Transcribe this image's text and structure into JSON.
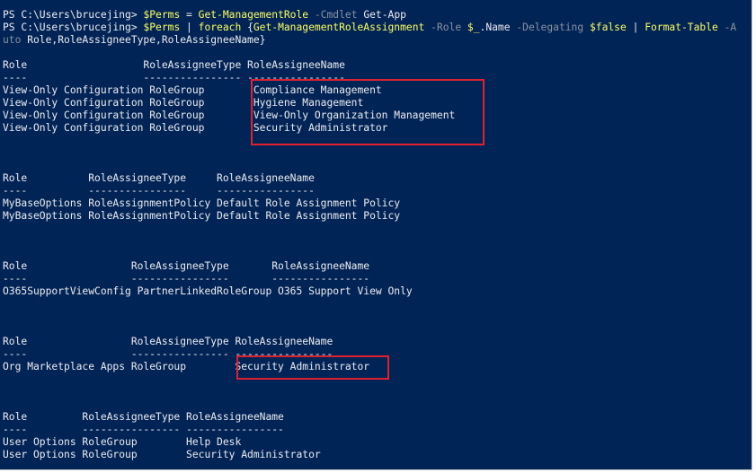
{
  "prompt": {
    "line1": {
      "ps": "PS C:\\Users\\brucejing> ",
      "var": "$Perms",
      "eq": " = ",
      "cmd": "Get-ManagementRole",
      "param": " -Cmdlet",
      "arg": " Get-App"
    },
    "line2": {
      "ps": "PS C:\\Users\\brucejing> ",
      "var": "$Perms",
      "pipe": " | ",
      "kw": "foreach",
      "brace": " {",
      "cmd": "Get-ManagementRoleAssignment",
      "p_role": " -Role ",
      "var2": "$_",
      "name": ".Name",
      "p_deleg": " -Delegating ",
      "var_false": "$false",
      "pipe2": " | ",
      "cmd2": "Format-Table",
      "param_a": " -A"
    },
    "line3": {
      "wrap": "uto",
      "args": " Role,RoleAssigneeType,RoleAssigneeName}"
    }
  },
  "blocks": [
    {
      "header": "Role                   RoleAssigneeType RoleAssigneeName",
      "underline": "----                   ---------------- ----------------",
      "rows": [
        "View-Only Configuration RoleGroup        Compliance Management",
        "View-Only Configuration RoleGroup        Hygiene Management",
        "View-Only Configuration RoleGroup        View-Only Organization Management",
        "View-Only Configuration RoleGroup        Security Administrator"
      ]
    },
    {
      "header": "Role          RoleAssigneeType     RoleAssigneeName",
      "underline": "----          ----------------     ----------------",
      "rows": [
        "MyBaseOptions RoleAssignmentPolicy Default Role Assignment Policy",
        "MyBaseOptions RoleAssignmentPolicy Default Role Assignment Policy"
      ]
    },
    {
      "header": "Role                 RoleAssigneeType       RoleAssigneeName",
      "underline": "----                 ----------------       ----------------",
      "rows": [
        "O365SupportViewConfig PartnerLinkedRoleGroup O365 Support View Only"
      ]
    },
    {
      "header": "Role                 RoleAssigneeType RoleAssigneeName",
      "underline": "----                 ---------------- ----------------",
      "rows": [
        "Org Marketplace Apps RoleGroup        Security Administrator"
      ]
    },
    {
      "header": "Role         RoleAssigneeType RoleAssigneeName",
      "underline": "----         ---------------- ----------------",
      "rows": [
        "User Options RoleGroup        Help Desk",
        "User Options RoleGroup        Security Administrator"
      ]
    }
  ],
  "colors": {
    "background": "#012456",
    "text": "#eeedf0",
    "command": "#ffff60",
    "parameter": "#8a93a0",
    "highlight_box": "#e02030"
  }
}
